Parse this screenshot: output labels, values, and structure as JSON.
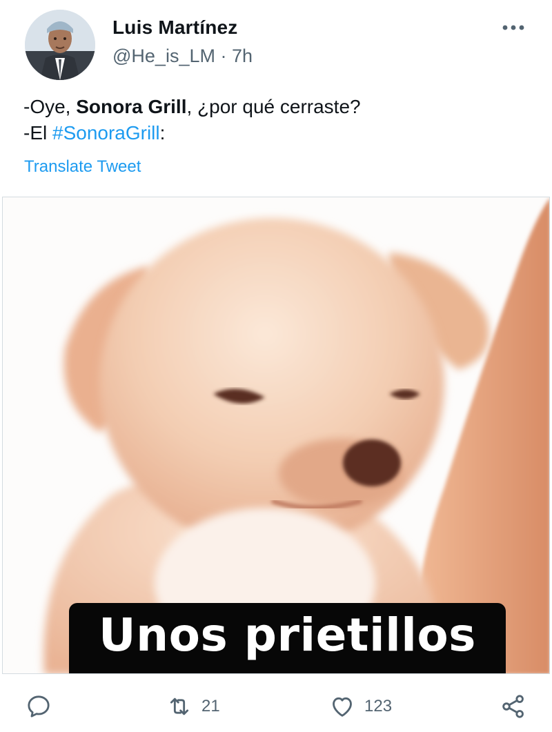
{
  "author": {
    "display_name": "Luis Martínez",
    "handle": "@He_is_LM",
    "separator": "·",
    "time": "7h",
    "avatar_icon": "profile-photo"
  },
  "more_icon": "more-horizontal-icon",
  "tweet": {
    "line1_prefix": "-Oye, ",
    "line1_bold": "Sonora Grill",
    "line1_suffix": ", ¿por qué cerraste?",
    "line2_prefix": "-El ",
    "line2_hashtag": "#SonoraGrill",
    "line2_suffix": ":"
  },
  "translate_label": "Translate Tweet",
  "media": {
    "caption": "Unos prietillos"
  },
  "actions": {
    "reply_icon": "reply-icon",
    "retweet_icon": "retweet-icon",
    "retweet_count": "21",
    "like_icon": "like-icon",
    "like_count": "123",
    "share_icon": "share-icon"
  },
  "colors": {
    "link": "#1d9bf0",
    "secondary_text": "#536471",
    "primary_text": "#0f1419"
  }
}
